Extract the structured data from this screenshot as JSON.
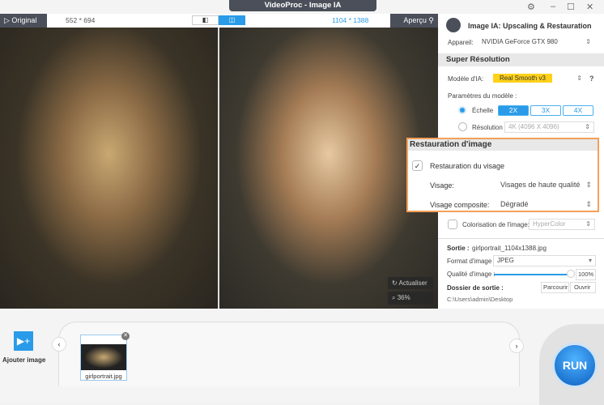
{
  "window": {
    "title": "VideoProc - Image IA"
  },
  "preview": {
    "original_label": "Original",
    "original_size": "552 * 694",
    "output_size": "1104 * 1388",
    "apercu_label": "Aperçu",
    "refresh_label": "Actualiser",
    "zoom_level": "36%"
  },
  "panel": {
    "header": "Image IA: Upscaling & Restauration",
    "device_label": "Appareil:",
    "device_value": "NVIDIA GeForce GTX 980",
    "super_resolution": {
      "title": "Super Résolution",
      "model_label": "Modèle d'IA:",
      "model_value": "Real Smooth v3",
      "params_label": "Paramètres du modèle :",
      "scale_label": "Échelle",
      "scale_options": [
        "2X",
        "3X",
        "4X"
      ],
      "scale_selected": "2X",
      "resolution_label": "Résolution",
      "resolution_value": "4K (4096 X 4096)",
      "mode": "Échelle"
    },
    "restoration": {
      "title": "Restauration d'image",
      "face_restore_label": "Restauration du visage",
      "face_restore_checked": true,
      "face_label": "Visage:",
      "face_value": "Visages de haute qualité",
      "composite_label": "Visage composite:",
      "composite_value": "Dégradé"
    },
    "colorization": {
      "label": "Colorisation de l'image:",
      "value": "HyperColor",
      "checked": false
    },
    "output": {
      "sortie_label": "Sortie :",
      "sortie_value": "girlportrait_1104x1388.jpg",
      "format_label": "Format d'image :",
      "format_value": "JPEG",
      "quality_label": "Qualité d'image :",
      "quality_value": "100%",
      "quality_percent": 100,
      "folder_label": "Dossier de sortie :",
      "browse_label": "Parcourir",
      "open_label": "Ouvrir",
      "folder_path": "C:\\Users\\admin\\Desktop"
    }
  },
  "bottom": {
    "add_image_label": "Ajouter image",
    "files": [
      {
        "name": "girlportrait.jpg"
      }
    ],
    "run_label": "RUN"
  },
  "colors": {
    "accent": "#2a9be8",
    "highlight": "#f5a05a",
    "model_badge": "#ffd21a"
  }
}
